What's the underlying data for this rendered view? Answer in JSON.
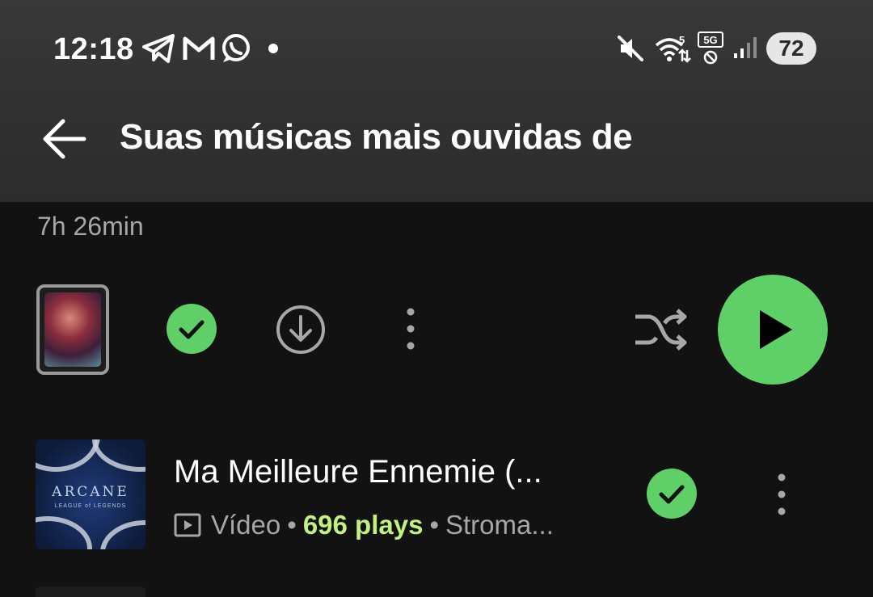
{
  "status_bar": {
    "time": "12:18",
    "notification_icons": [
      "telegram-icon",
      "gmail-icon",
      "whatsapp-icon"
    ],
    "system_icons": [
      "mute-icon",
      "wifi-icon",
      "5g-icon",
      "signal-icon"
    ],
    "wifi_label": "5",
    "network_label": "5G",
    "battery": "72"
  },
  "header": {
    "title": "Suas músicas mais ouvidas de"
  },
  "playlist": {
    "duration": "7h 26min"
  },
  "colors": {
    "accent": "#5fd068",
    "plays_highlight": "#c3f07f",
    "secondary_text": "#a7a7a7",
    "background": "#121212"
  },
  "tracks": [
    {
      "title": "Ma Meilleure Ennemie (...",
      "type": "Vídeo",
      "plays": "696 plays",
      "artist": "Stroma...",
      "art_title": "ARCANE",
      "art_subtitle": "LEAGUE of LEGENDS"
    }
  ]
}
